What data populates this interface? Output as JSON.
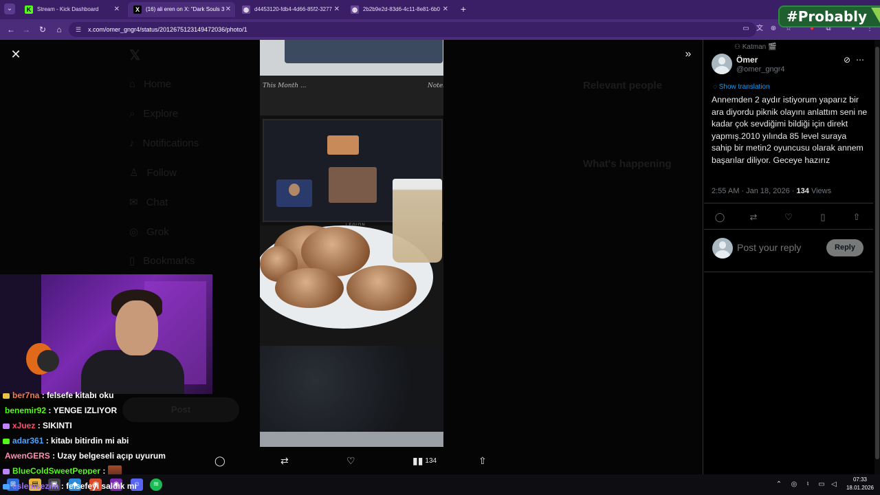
{
  "browser": {
    "tabs": [
      {
        "title": "Stream - Kick Dashboard",
        "favicon": "K",
        "favicon_color": "#53fc18"
      },
      {
        "title": "(16) ali eren on X: \"Dark Souls 3",
        "favicon": "X",
        "favicon_color": "#000000"
      },
      {
        "title": "d4453120-fdb4-4d66-85f2-3277",
        "favicon": "◍",
        "favicon_color": "#6b4a9a"
      },
      {
        "title": "2b2b9e2d-83d6-4c11-8e81-6b0",
        "favicon": "◍",
        "favicon_color": "#6b4a9a"
      }
    ],
    "active_tab": 1,
    "url": "x.com/omer_gngr4/status/2012675123149472036/photo/1",
    "overlay_badge": "#Probably"
  },
  "backdrop": {
    "nav": [
      "Home",
      "Explore",
      "Notifications",
      "Follow",
      "Chat",
      "Grok",
      "Bookmarks"
    ],
    "post_button": "Post",
    "sidebar_heading_people": "Relevant people",
    "sidebar_heading_happening": "What's happening"
  },
  "photo_caption": {
    "board_left": "This Month ...",
    "board_right": "Notes",
    "laptop_brand": "LEGION"
  },
  "chat": [
    {
      "user": "ber7na",
      "message": "felsefe kitabı oku",
      "color": "#ff7a45",
      "badge": "#e8c34a"
    },
    {
      "user": "benemir92",
      "message": "YENGE IZLIYOR",
      "color": "#53fc18",
      "badge": ""
    },
    {
      "user": "xJuez",
      "message": "SIKINTI",
      "color": "#ff4d6d",
      "badge": "#c084fc"
    },
    {
      "user": "adar361",
      "message": "kitabı bitirdin mi abi",
      "color": "#4aa3ff",
      "badge": "#53fc18"
    },
    {
      "user": "AwenGERS",
      "message": "Uzay belgeseli açıp uyurum",
      "color": "#ff8fb1",
      "badge": ""
    },
    {
      "user": "BlueColdSweetPepper",
      "message": "",
      "color": "#53fc18",
      "badge": "#c084fc"
    },
    {
      "user": "eslemsezim",
      "message": "felsefeyi saldık mı",
      "color": "#9b6dff",
      "badge": "#4aa3ff"
    }
  ],
  "photo_actions": {
    "views": "134"
  },
  "tweet": {
    "context_label": "Katman 🎬",
    "author_name": "Ömer",
    "author_handle": "@omer_gngr4",
    "translate_label": "Show translation",
    "text": "Annemden 2 aydır istiyorum yaparız bir ara diyordu piknik olayını anlattım seni ne kadar çok sevdiğimi bildiği için direkt yapmış.2010 yılında 85 level suraya sahip bir metin2 oyuncusu olarak annem başarılar diliyor. Geceye hazırız",
    "timestamp": "2:55 AM · Jan 18, 2026 ·",
    "views_count": "134",
    "views_label": "Views",
    "reply_placeholder": "Post your reply",
    "reply_button": "Reply"
  },
  "taskbar": {
    "time": "07:33",
    "date": "18.01.2026"
  },
  "colors": {
    "accent": "#1d9bf0",
    "browser_frame": "#4b2c7a",
    "tabbar": "#3b1f66"
  }
}
